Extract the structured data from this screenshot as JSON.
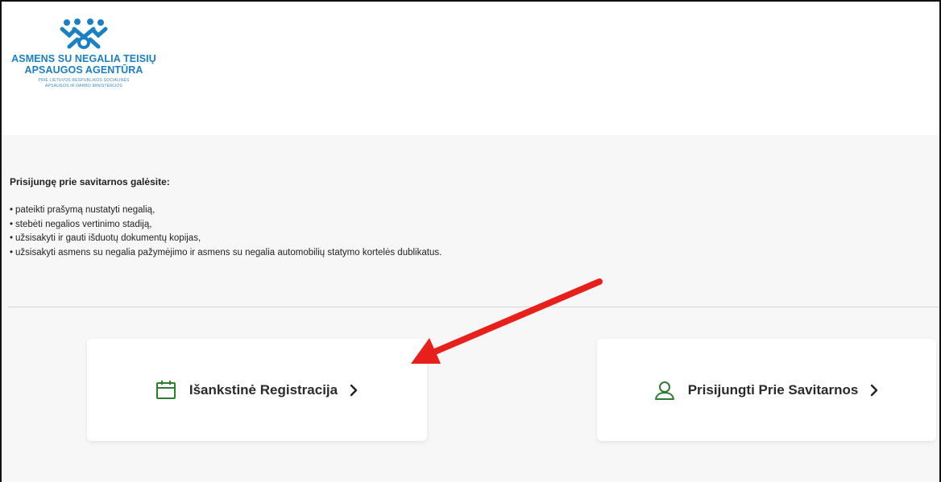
{
  "header": {
    "logo": {
      "line1": "ASMENS SU NEGALIA TEISIŲ",
      "line2": "APSAUGOS AGENTŪRA",
      "subline1": "PRIE LIETUVOS RESPUBLIKOS SOCIALINĖS",
      "subline2": "APSAUGOS IR DARBO MINISTERIJOS"
    }
  },
  "intro": {
    "heading": "Prisijungę prie savitarnos galėsite:",
    "items": [
      "pateikti prašymą nustatyti negalią,",
      "stebėti negalios vertinimo stadiją,",
      "užsisakyti ir gauti išduotų dokumentų kopijas,",
      "užsisakyti asmens su negalia pažymėjimo ir asmens su negalia automobilių statymo kortelės dublikatus."
    ]
  },
  "cards": {
    "left": {
      "label": "Išankstinė Registracija",
      "icon": "calendar-icon",
      "chevron": "chevron-right-icon"
    },
    "right": {
      "label": "Prisijungti Prie Savitarnos",
      "icon": "user-icon",
      "chevron": "chevron-right-icon"
    }
  },
  "colors": {
    "brand_blue": "#1a7fc4",
    "icon_green": "#2e7d32",
    "annotation_red": "#e8201c",
    "background": "#f7f7f7"
  }
}
